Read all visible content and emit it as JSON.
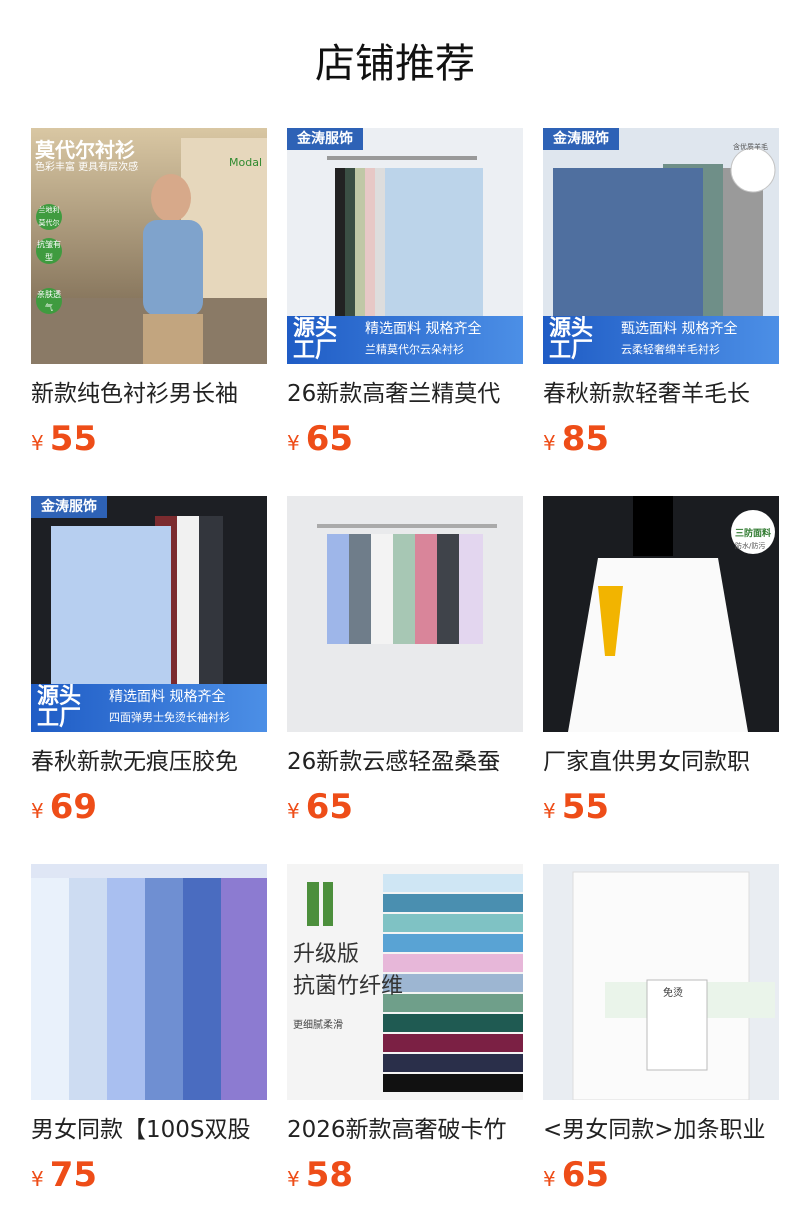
{
  "section_title": "店铺推荐",
  "currency": "¥",
  "products": [
    {
      "name": "新款纯色衬衫男长袖",
      "price": "55",
      "image_text": {
        "headline": "莫代尔衬衫",
        "sub": "色彩丰富 更具有层次感",
        "logo": "Modal",
        "tags": [
          "兰地利莫代尔",
          "抗皱有型",
          "亲肤透气"
        ]
      }
    },
    {
      "name": "26新款高奢兰精莫代",
      "price": "65",
      "image_text": {
        "brand": "金涛服饰",
        "banner_big": "源头工厂",
        "banner_line1": "精选面料 规格齐全",
        "banner_line2": "兰精莫代尔云朵衬衫"
      }
    },
    {
      "name": "春秋新款轻奢羊毛长",
      "price": "85",
      "image_text": {
        "brand": "金涛服饰",
        "badge_round": "含优质羊毛",
        "banner_big": "源头工厂",
        "banner_line1": "甄选面料 规格齐全",
        "banner_line2": "云柔轻奢绵羊毛衬衫"
      }
    },
    {
      "name": "春秋新款无痕压胶免",
      "price": "69",
      "image_text": {
        "brand": "金涛服饰",
        "banner_big": "源头工厂",
        "banner_line1": "精选面料 规格齐全",
        "banner_line2": "四面弹男士免烫长袖衬衫"
      }
    },
    {
      "name": "26新款云感轻盈桑蚕",
      "price": "65",
      "image_text": {}
    },
    {
      "name": "厂家直供男女同款职",
      "price": "55",
      "image_text": {
        "badge_round": "三防面料",
        "badge_sub": "防水/防污"
      }
    },
    {
      "name": "男女同款【100S双股",
      "price": "75",
      "image_text": {}
    },
    {
      "name": "2026新款高奢破卡竹",
      "price": "58",
      "image_text": {
        "line1": "升级版",
        "line2": "抗菌竹纤维",
        "line3": "更细腻柔滑"
      }
    },
    {
      "name": "<男女同款>加条职业",
      "price": "65",
      "image_text": {
        "pack_label": "免烫"
      }
    }
  ]
}
